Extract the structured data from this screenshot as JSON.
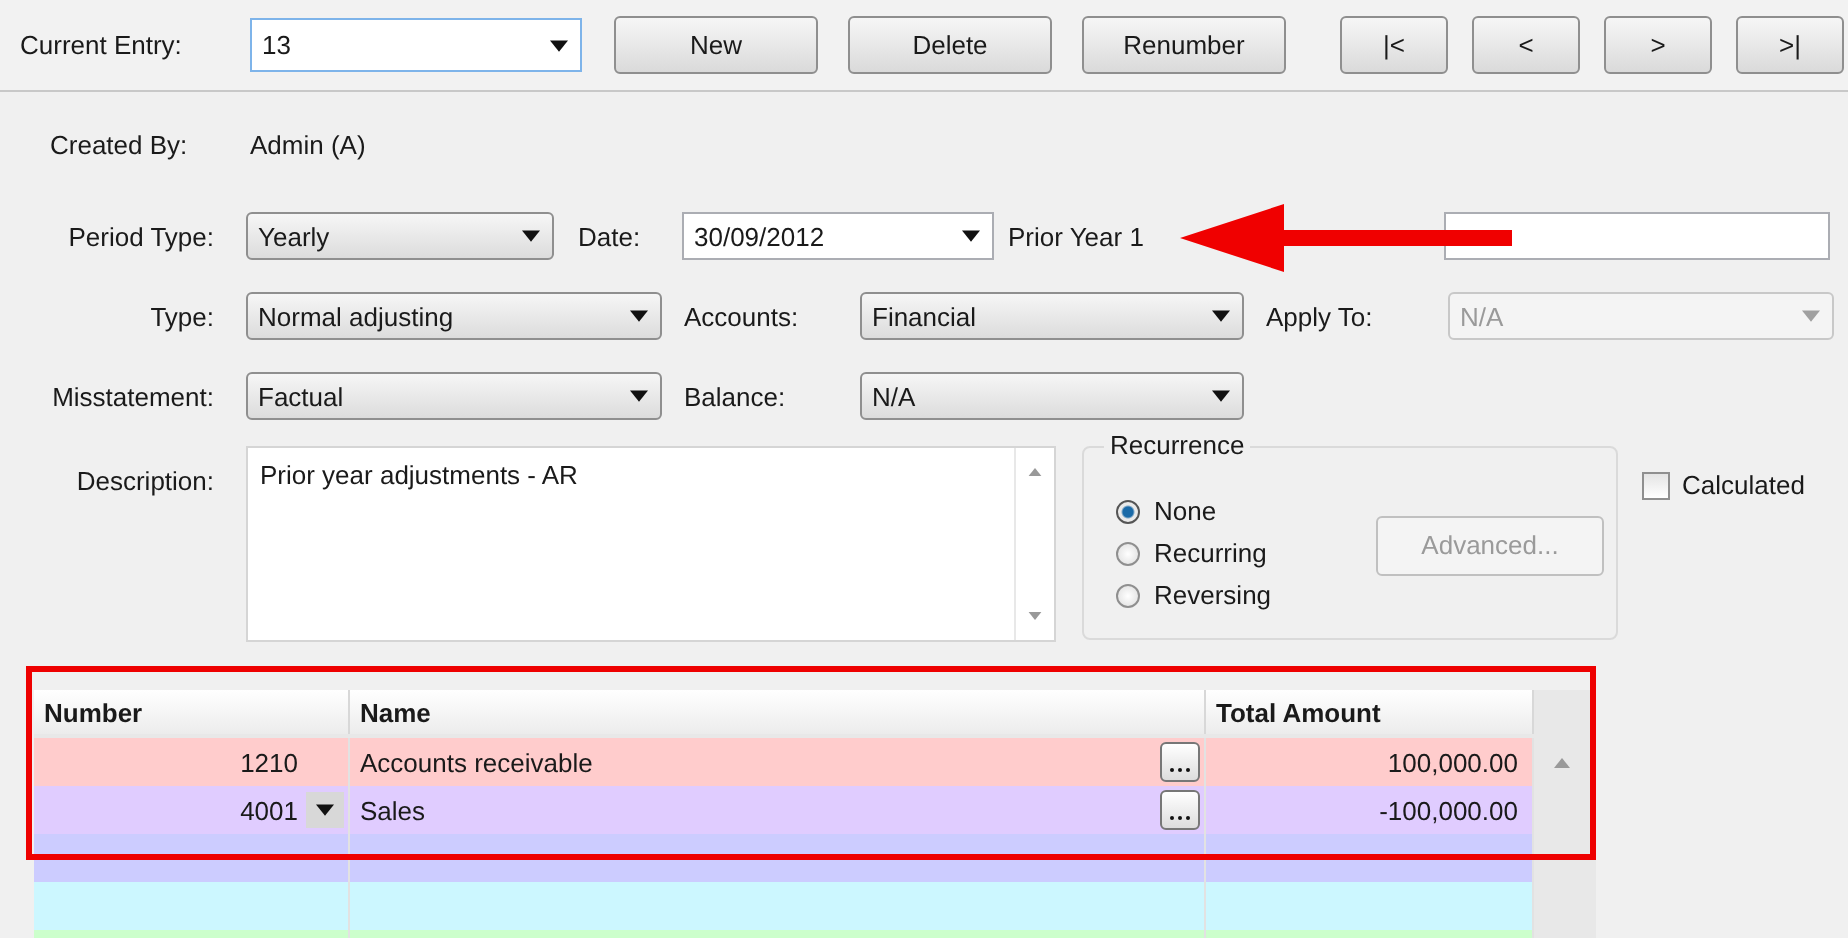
{
  "toolbar": {
    "current_entry_label": "Current Entry:",
    "current_entry": "13",
    "buttons": [
      "New",
      "Delete",
      "Renumber"
    ],
    "nav_buttons": [
      "|<",
      "<",
      ">",
      ">|"
    ]
  },
  "created_by": {
    "label": "Created By:",
    "value": "Admin (A)"
  },
  "period_type": {
    "label": "Period Type:",
    "value": "Yearly"
  },
  "date": {
    "label": "Date:",
    "value": "30/09/2012"
  },
  "prior_year": "Prior Year 1",
  "type": {
    "label": "Type:",
    "value": "Normal adjusting"
  },
  "accounts": {
    "label": "Accounts:",
    "value": "Financial"
  },
  "apply_to": {
    "label": "Apply To:",
    "value": "N/A",
    "disabled": true
  },
  "misstatement": {
    "label": "Misstatement:",
    "value": "Factual"
  },
  "balance": {
    "label": "Balance:",
    "value": "N/A"
  },
  "description": {
    "label": "Description:",
    "value": "Prior year adjustments - AR"
  },
  "recurrence": {
    "title": "Recurrence",
    "options": [
      {
        "label": "None",
        "selected": true
      },
      {
        "label": "Recurring",
        "selected": false
      },
      {
        "label": "Reversing",
        "selected": false
      }
    ],
    "advanced": {
      "label": "Advanced...",
      "disabled": true
    }
  },
  "calculated": {
    "label": "Calculated",
    "checked": false
  },
  "table": {
    "highlighted": true,
    "columns": [
      "Number",
      "Name",
      "Total Amount"
    ],
    "rows": [
      {
        "number": "1210",
        "name": "Accounts receivable",
        "amount": "100,000.00",
        "color": "#ffcccc",
        "dropdown": false
      },
      {
        "number": "4001",
        "name": "Sales",
        "amount": "-100,000.00",
        "color": "#e0ccff",
        "dropdown": true
      }
    ],
    "empty_rows": [
      {
        "color": "#ccccff"
      },
      {
        "color": "#ccf7ff"
      },
      {
        "color": "#ccffcc"
      }
    ]
  }
}
